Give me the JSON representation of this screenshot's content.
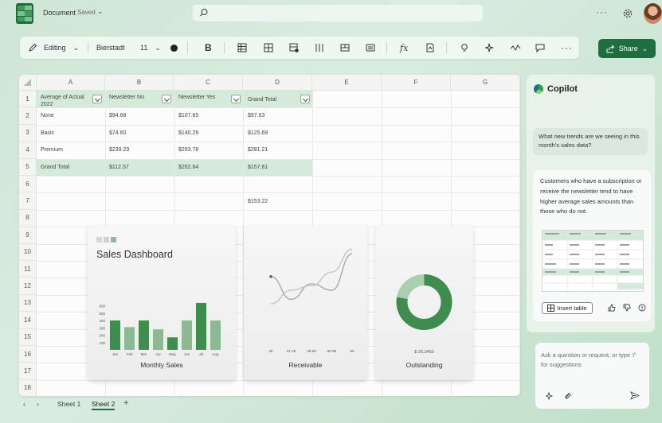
{
  "titlebar": {
    "doc_title": "Document",
    "saved_label": "Saved",
    "icons": [
      "excel-logo-icon",
      "search-icon",
      "more-icon",
      "gear-icon",
      "avatar"
    ]
  },
  "ribbon": {
    "mode_label": "Editing",
    "font_name": "Bierstadt",
    "font_size": "11",
    "bold_label": "B",
    "fx_label": "fx"
  },
  "share": {
    "label": "Share"
  },
  "sheet": {
    "columns": [
      "A",
      "B",
      "C",
      "D",
      "E",
      "F",
      "G"
    ],
    "rows": [
      "1",
      "2",
      "3",
      "4",
      "5",
      "6",
      "7",
      "8",
      "9",
      "10",
      "11",
      "12",
      "13",
      "14",
      "15",
      "16",
      "17",
      "18"
    ],
    "headers": [
      "Average of Actual 2022",
      "Newsletter No",
      "Newsletter Yes",
      "Grand Total"
    ],
    "data_rows": [
      [
        "None",
        "$94.68",
        "$107.65",
        "$97.63"
      ],
      [
        "Basic",
        "$74.60",
        "$140.29",
        "$125.69"
      ],
      [
        "Premium",
        "$239.29",
        "$293.78",
        "$281.21"
      ]
    ],
    "total_row": [
      "Grand Total",
      "$112.57",
      "$202.64",
      "$157.61"
    ],
    "extra_value": "$153.22"
  },
  "dashboard": {
    "title": "Sales Dashboard",
    "monthly_caption": "Monthly Sales",
    "receivable_caption": "Receivable",
    "outstanding_caption": "Outstanding",
    "outstanding_value": "$ 26,3450"
  },
  "chart_data": [
    {
      "type": "bar",
      "title": "Monthly Sales",
      "categories": [
        "Jan",
        "Feb",
        "Mar",
        "Apr",
        "May",
        "Jun",
        "Jul",
        "Aug"
      ],
      "y_ticks": [
        "600",
        "500",
        "400",
        "300",
        "200",
        "100"
      ],
      "ylim": [
        0,
        650
      ],
      "series": [
        {
          "values": [
            400,
            310,
            400,
            280,
            170,
            400,
            640,
            400
          ]
        }
      ],
      "colors": [
        "#3f8c4e",
        "#8db894",
        "#3f8c4e",
        "#8db894",
        "#3f8c4e",
        "#8db894",
        "#3f8c4e",
        "#8db894"
      ]
    },
    {
      "type": "line",
      "title": "Receivable",
      "categories": [
        "30",
        "31-45",
        "46-60",
        "60-90",
        "90"
      ],
      "series": [
        {
          "values": [
            70,
            45,
            62,
            55,
            95
          ]
        },
        {
          "values": [
            40,
            55,
            60,
            75,
            100
          ]
        }
      ]
    },
    {
      "type": "pie",
      "title": "Outstanding",
      "values": [
        78,
        22
      ],
      "colors": [
        "#3f8c4e",
        "#a9cfb0"
      ]
    }
  ],
  "sheet_tabs": [
    "Sheet 1",
    "Sheet 2"
  ],
  "add_sheet_label": "+",
  "copilot": {
    "title": "Copilot",
    "user_message": "What new trends are we seeing in this month's sales data?",
    "ai_message": "Customers who have a subscription or receive the newsletter tend to have higher average sales amounts than those who do not.",
    "insert_table_label": "Insert table",
    "ask_placeholder": "Ask a question or request, or type '/' for suggestions"
  },
  "colors": {
    "accent": "#1f6e3f",
    "header_fill": "#d6eadb"
  }
}
